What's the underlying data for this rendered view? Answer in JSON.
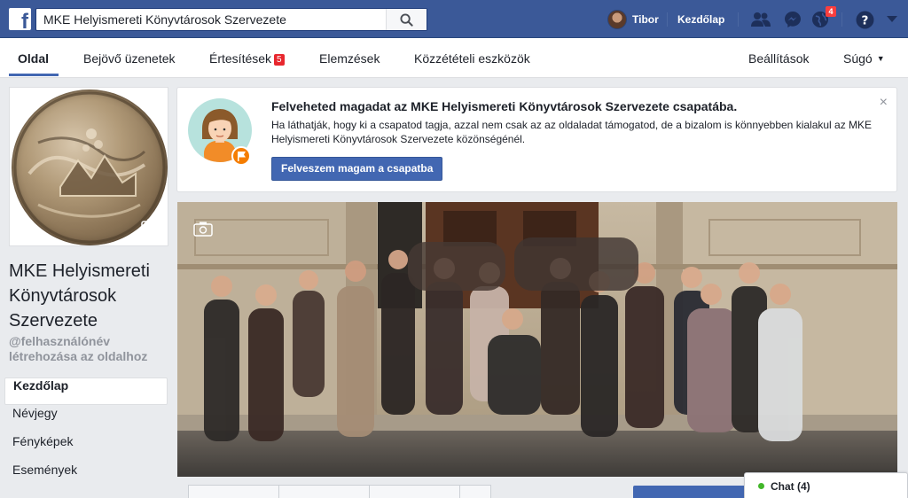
{
  "topbar": {
    "logo_letter": "f",
    "search_value": "MKE Helyismereti Könyvtárosok Szervezete",
    "user_name": "Tibor",
    "home_link": "Kezdőlap",
    "notifications_count": "4"
  },
  "subnav": {
    "tabs": [
      {
        "label": "Oldal"
      },
      {
        "label": "Bejövő üzenetek"
      },
      {
        "label": "Értesítések",
        "badge": "5"
      },
      {
        "label": "Elemzések"
      },
      {
        "label": "Közzétételi eszközök"
      }
    ],
    "settings": "Beállítások",
    "help": "Súgó"
  },
  "page": {
    "name": "MKE Helyismereti Könyvtárosok Szervezete",
    "username_prompt": "@felhasználónév létrehozása az oldalhoz"
  },
  "leftnav": {
    "items": [
      {
        "label": "Kezdőlap"
      },
      {
        "label": "Névjegy"
      },
      {
        "label": "Fényképek"
      },
      {
        "label": "Események"
      }
    ]
  },
  "join_card": {
    "title": "Felveheted magadat az MKE Helyismereti Könyvtárosok Szervezete csapatába.",
    "text": "Ha láthatják, hogy ki a csapatod tagja, azzal nem csak az az oldaladat támogatod, de a bizalom is könnyebben kialakul az MKE Helyismereti Könyvtárosok Szervezete közönségénél.",
    "button": "Felveszem magam a csapatba",
    "close": "×"
  },
  "chat": {
    "label": "Chat (4)"
  },
  "colors": {
    "brand": "#3b5998",
    "button": "#4267b2",
    "badge": "#fa3e3e",
    "online": "#42b72a"
  }
}
